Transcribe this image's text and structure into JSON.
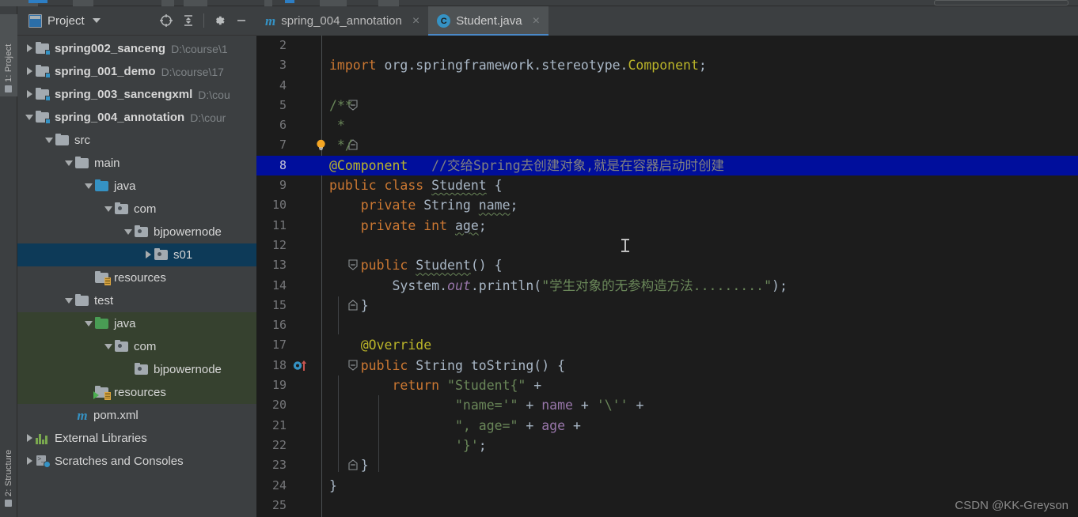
{
  "window": {
    "project_panel": {
      "title": "Project",
      "icons": [
        "project-icon",
        "chevron-down-icon",
        "locate-icon",
        "collapse-all-icon",
        "gear-icon",
        "minimize-icon"
      ]
    },
    "tool_buttons": [
      {
        "label": "1: Project",
        "active": true
      },
      {
        "label": "2: Structure",
        "active": false
      }
    ]
  },
  "tree": [
    {
      "indent": 0,
      "arrow": "closed",
      "icon": "module-folder",
      "name": "spring002_sanceng",
      "path": "D:\\course\\1",
      "bold": true
    },
    {
      "indent": 0,
      "arrow": "closed",
      "icon": "module-folder",
      "name": "spring_001_demo",
      "path": "D:\\course\\17",
      "bold": true
    },
    {
      "indent": 0,
      "arrow": "closed",
      "icon": "module-folder",
      "name": "spring_003_sancengxml",
      "path": "D:\\cou",
      "bold": true
    },
    {
      "indent": 0,
      "arrow": "open",
      "icon": "module-folder",
      "name": "spring_004_annotation",
      "path": "D:\\cour",
      "bold": true
    },
    {
      "indent": 1,
      "arrow": "open",
      "icon": "folder",
      "name": "src",
      "path": "",
      "bold": false
    },
    {
      "indent": 2,
      "arrow": "open",
      "icon": "folder",
      "name": "main",
      "path": "",
      "bold": false
    },
    {
      "indent": 3,
      "arrow": "open",
      "icon": "folder-blue",
      "name": "java",
      "path": "",
      "bold": false
    },
    {
      "indent": 4,
      "arrow": "open",
      "icon": "package",
      "name": "com",
      "path": "",
      "bold": false
    },
    {
      "indent": 5,
      "arrow": "open",
      "icon": "package",
      "name": "bjpowernode",
      "path": "",
      "bold": false
    },
    {
      "indent": 6,
      "arrow": "closed",
      "icon": "package",
      "name": "s01",
      "path": "",
      "bold": false,
      "selected": true
    },
    {
      "indent": 3,
      "arrow": "none",
      "icon": "resources-folder",
      "name": "resources",
      "path": "",
      "bold": false
    },
    {
      "indent": 2,
      "arrow": "open",
      "icon": "folder",
      "name": "test",
      "path": "",
      "bold": false
    },
    {
      "indent": 3,
      "arrow": "open",
      "icon": "folder-green",
      "name": "java",
      "path": "",
      "bold": false,
      "test": true
    },
    {
      "indent": 4,
      "arrow": "open",
      "icon": "package",
      "name": "com",
      "path": "",
      "bold": false,
      "test": true
    },
    {
      "indent": 5,
      "arrow": "none",
      "icon": "package",
      "name": "bjpowernode",
      "path": "",
      "bold": false,
      "test": true
    },
    {
      "indent": 3,
      "arrow": "none",
      "icon": "test-resources-folder",
      "name": "resources",
      "path": "",
      "bold": false,
      "test": true
    },
    {
      "indent": 2,
      "arrow": "none",
      "icon": "maven-icon",
      "name": "pom.xml",
      "path": "",
      "bold": false
    },
    {
      "indent": 0,
      "arrow": "closed",
      "icon": "libraries-icon",
      "name": "External Libraries",
      "path": "",
      "bold": false
    },
    {
      "indent": 0,
      "arrow": "closed",
      "icon": "scratches-icon",
      "name": "Scratches and Consoles",
      "path": "",
      "bold": false
    }
  ],
  "editor": {
    "tabs": [
      {
        "label": "spring_004_annotation",
        "icon": "maven-icon",
        "active": false,
        "close": "×"
      },
      {
        "label": "Student.java",
        "icon": "java-class-icon",
        "active": true,
        "close": "×"
      }
    ],
    "first_visible_line": 2,
    "highlighted_line": 8,
    "lines": [
      {
        "n": "2",
        "html": ""
      },
      {
        "n": "3",
        "html": "<span class=\"k\">import</span> org.springframework.stereotype.<span class=\"an\">Component</span>;"
      },
      {
        "n": "4",
        "html": ""
      },
      {
        "n": "5",
        "html": "<span class=\"s\">/**</span>",
        "fold": "start"
      },
      {
        "n": "6",
        "html": "<span class=\"s\"> *</span>"
      },
      {
        "n": "7",
        "html": "<span class=\"s\"> */</span>",
        "fold": "end",
        "bulb": true
      },
      {
        "n": "8",
        "html": "<span class=\"an\">@Component</span>   <span class=\"cmt-cn\">//交给Spring去创建对象,就是在容器启动时创建</span>",
        "highlight": true
      },
      {
        "n": "9",
        "html": "<span class=\"k\">public class</span> <span class=\"err\">Student</span> {"
      },
      {
        "n": "10",
        "html": "    <span class=\"k\">private</span> String <span class=\"err\">name</span>;"
      },
      {
        "n": "11",
        "html": "    <span class=\"k\">private</span> <span class=\"k\">int</span> <span class=\"err\">age</span>;"
      },
      {
        "n": "12",
        "html": "",
        "caret": true
      },
      {
        "n": "13",
        "html": "    <span class=\"k\">public</span> <span class=\"err\">Student</span>() {",
        "fold": "start"
      },
      {
        "n": "14",
        "html": "        System.<span class=\"f\"><i>out</i></span>.println(<span class=\"s\">\"学生对象的无参构造方法.........\"</span>);"
      },
      {
        "n": "15",
        "html": "    }",
        "fold": "end"
      },
      {
        "n": "16",
        "html": ""
      },
      {
        "n": "17",
        "html": "    <span class=\"an\">@Override</span>"
      },
      {
        "n": "18",
        "html": "    <span class=\"k\">public</span> String toString() {",
        "fold": "start",
        "override": true
      },
      {
        "n": "19",
        "html": "        <span class=\"k\">return</span> <span class=\"s\">\"Student{\"</span> +"
      },
      {
        "n": "20",
        "html": "                <span class=\"s\">\"name='\"</span> + <span class=\"f\">name</span> + <span class=\"s\">'\\''</span> +"
      },
      {
        "n": "21",
        "html": "                <span class=\"s\">\", age=\"</span> + <span class=\"f\">age</span> +"
      },
      {
        "n": "22",
        "html": "                <span class=\"s\">'}'</span>;"
      },
      {
        "n": "23",
        "html": "    }",
        "fold": "end"
      },
      {
        "n": "24",
        "html": "}"
      },
      {
        "n": "25",
        "html": ""
      }
    ]
  },
  "watermark": "CSDN @KK-Greyson",
  "colors": {
    "panel_bg": "#3c3f41",
    "editor_bg": "#1c1c1c",
    "selection_blue": "#0d3a58",
    "line_highlight": "#000e9c",
    "test_green": "#36412f",
    "accent": "#3592c4",
    "keyword": "#cc7832",
    "string": "#6a8759",
    "annotation": "#bbb529",
    "field": "#9876aa",
    "comment": "#808080"
  }
}
